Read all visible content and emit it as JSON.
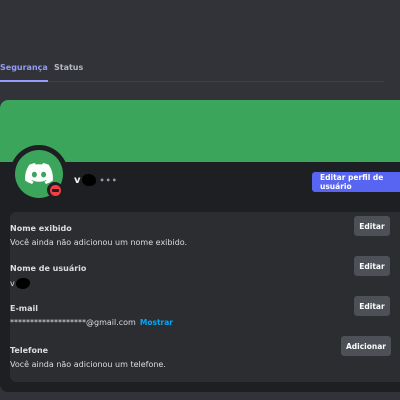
{
  "tabs": [
    {
      "label": "Segurança",
      "active": true
    },
    {
      "label": "Status",
      "active": false
    }
  ],
  "profile": {
    "username_visible": "v",
    "username_suffix": "•••",
    "edit_profile_label": "Editar perfil de usuário",
    "banner_color": "#3ba55c",
    "status": "do-not-disturb"
  },
  "fields": {
    "display_name": {
      "label": "Nome exibido",
      "value": "Você ainda não adicionou um nome exibido.",
      "action": "Editar"
    },
    "username": {
      "label": "Nome de usuário",
      "value": "v",
      "action": "Editar"
    },
    "email": {
      "label": "E-mail",
      "value": "*******************@gmail.com",
      "reveal": "Mostrar",
      "action": "Editar"
    },
    "phone": {
      "label": "Telefone",
      "value": "Você ainda não adicionou um telefone.",
      "action": "Adicionar"
    }
  },
  "colors": {
    "accent": "#5865f2",
    "tab_active": "#949cf7",
    "link": "#00a8fc",
    "dnd": "#f23f43"
  }
}
